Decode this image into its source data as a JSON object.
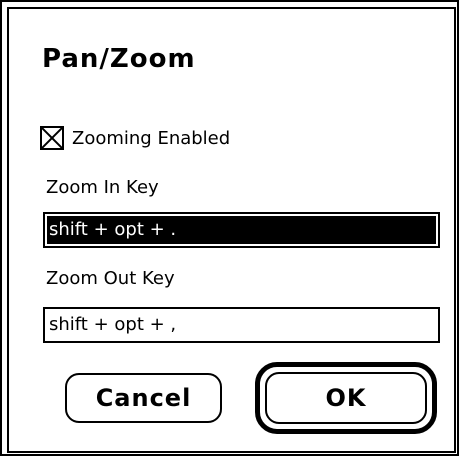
{
  "dialog": {
    "title": "Pan/Zoom"
  },
  "zooming": {
    "label": "Zooming Enabled",
    "checked": true
  },
  "zoom_in": {
    "label": "Zoom In Key",
    "value": "shift + opt + ."
  },
  "zoom_out": {
    "label": "Zoom Out Key",
    "value": "shift + opt + ,"
  },
  "buttons": {
    "cancel_label": "Cancel",
    "ok_label": "OK"
  },
  "colors": {
    "foreground": "#000000",
    "background": "#ffffff"
  }
}
